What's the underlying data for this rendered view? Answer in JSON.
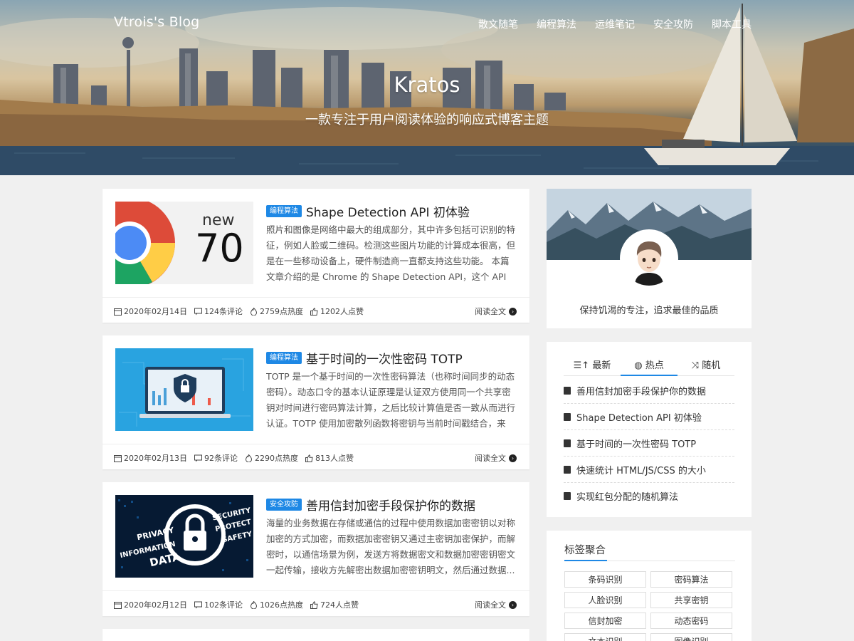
{
  "header": {
    "brand": "Vtrois's Blog",
    "nav": [
      "散文随笔",
      "编程算法",
      "运维笔记",
      "安全攻防",
      "脚本工具"
    ],
    "title": "Kratos",
    "subtitle": "一款专注于用户阅读体验的响应式博客主题"
  },
  "posts": [
    {
      "category": "编程算法",
      "title": "Shape Detection API 初体验",
      "summary": "照片和图像是网络中最大的组成部分，其中许多包括可识别的特征，例如人脸或二维码。检测这些图片功能的计算成本很高，但是在一些移动设备上，硬件制造商一直都支持这些功能。 本篇文章介绍的是 Chrome 的 Shape Detection API，这个 API 允许在...",
      "thumb_text_top": "new",
      "thumb_text_big": "70",
      "date": "2020年02月14日",
      "comments": "124条评论",
      "heat": "2759点热度",
      "likes": "1202人点赞",
      "read_more": "阅读全文"
    },
    {
      "category": "编程算法",
      "title": "基于时间的一次性密码 TOTP",
      "summary": "TOTP 是一个基于时间的一次性密码算法（也称时间同步的动态密码）。动态口令的基本认证原理是认证双方使用同一个共享密钥对时间进行密码算法计算，之后比较计算值是否一致从而进行认证。TOTP 使用加密散列函数将密钥与当前时间戳结合，来生...",
      "date": "2020年02月13日",
      "comments": "92条评论",
      "heat": "2290点热度",
      "likes": "813人点赞",
      "read_more": "阅读全文"
    },
    {
      "category": "安全攻防",
      "title": "善用信封加密手段保护你的数据",
      "summary": "海量的业务数据在存储或通信的过程中使用数据加密密钥以对称加密的方式加密，而数据加密密钥又通过主密钥加密保护，而解密时，以通信场景为例，发送方将数据密文和数据加密密钥密文一起传输，接收方先解密出数据加密密钥明文，然后通过数据...",
      "thumb_words": [
        "PRIVACY",
        "INFORMATION",
        "DATA",
        "SECURITY",
        "PROTECT",
        "SAFETY"
      ],
      "date": "2020年02月12日",
      "comments": "102条评论",
      "heat": "1026点热度",
      "likes": "724人点赞",
      "read_more": "阅读全文"
    }
  ],
  "sidebar": {
    "motto": "保持饥渴的专注，追求最佳的品质",
    "tabs": [
      "最新",
      "热点",
      "随机"
    ],
    "active_tab": "热点",
    "hot_list": [
      "善用信封加密手段保护你的数据",
      "Shape Detection API 初体验",
      "基于时间的一次性密码 TOTP",
      "快速统计 HTML/JS/CSS 的大小",
      "实现红包分配的随机算法"
    ],
    "tags_title": "标签聚合",
    "tags": [
      "条码识别",
      "密码算法",
      "人脸识别",
      "共享密钥",
      "信封加密",
      "动态密码",
      "文本识别",
      "图像识别"
    ]
  },
  "colors": {
    "accent": "#1e88e5",
    "background": "#f0f0f0",
    "card": "#ffffff"
  }
}
